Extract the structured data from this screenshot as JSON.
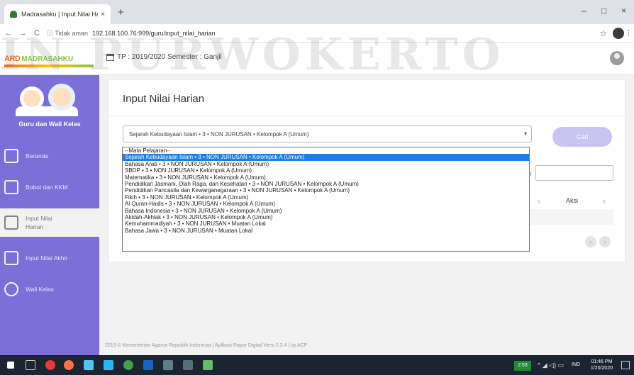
{
  "browser": {
    "tab_title": "Madrasahku | Input Nilai Harian",
    "tab_close": "×",
    "new_tab": "+",
    "window_controls": [
      "–",
      "□",
      "×"
    ],
    "security_text": "ⓘ Tidak aman",
    "url": "192.168.100.76:999/guru/input_nilai_harian",
    "nav_back": "←",
    "nav_forward": "→",
    "nav_reload": "C",
    "star": "☆",
    "menu": "⋮"
  },
  "header": {
    "logo_ard": "ARD",
    "logo_madrasahku": "MADRASAHKU",
    "tp_text": "TP : 2019/2020  Semester : Ganjil"
  },
  "watermark": "IN PURWOKERTO",
  "sidebar": {
    "role": "Guru dan Wali Kelas",
    "items": [
      {
        "label": "Beranda",
        "icon": "home-icon"
      },
      {
        "label": "Bobot dan KKM",
        "icon": "layers-icon"
      },
      {
        "label": "Input Nilai Harian",
        "icon": "document-icon"
      },
      {
        "label": "Input Nilai Akhir",
        "icon": "document-icon"
      },
      {
        "label": "Wali Kelas",
        "icon": "user-icon"
      }
    ]
  },
  "main": {
    "title": "Input Nilai Harian",
    "select_value": "Sejarah Kebudayaan Islam • 3 • NON JURUSAN • Kelompok A (Umum)",
    "select_arrow": "▾",
    "cari_label": "Cari",
    "search_label_fragment": "h",
    "aksi_label": "Aksi",
    "sort_glyph": "⇅",
    "pagination_prev": "‹",
    "pagination_next": "›",
    "options": [
      "--Mata Pelajaran--",
      "Sejarah Kebudayaan Islam • 3 • NON JURUSAN • Kelompok A (Umum)",
      "Bahasa Arab • 3 • NON JURUSAN • Kelompok A (Umum)",
      "SBDP • 3 • NON JURUSAN • Kelompok A (Umum)",
      "Matematika • 3 • NON JURUSAN • Kelompok A (Umum)",
      "Pendidikan Jasmani, Olah Raga, dan Kesehatan • 3 • NON JURUSAN • Kelompok A (Umum)",
      "Pendidikan Pancasila dan Kewarganegaraan • 3 • NON JURUSAN • Kelompok A (Umum)",
      "Fikih • 3 • NON JURUSAN • Kelompok A (Umum)",
      "Al Quran-Hadis • 3 • NON JURUSAN • Kelompok A (Umum)",
      "Bahasa Indonesia • 3 • NON JURUSAN • Kelompok A (Umum)",
      "Akidah-Akhlak • 3 • NON JURUSAN • Kelompok A (Umum)",
      "Kemuhammadiyah • 3 • NON JURUSAN • Muatan Lokal",
      "Bahasa Jawa • 3 • NON JURUSAN • Muatan Lokal"
    ],
    "selected_option_index": 1
  },
  "footer": "2019 © Kementerian Agama Republik Indonesia | Aplikasi Rapor Digital Versi 2.3.4 | by ACP",
  "taskbar": {
    "badge": "2:53",
    "tray": "^ ◢ ◁) ▭",
    "lang": "IND",
    "time": "01:46 PM",
    "date": "1/20/2020"
  },
  "colors": {
    "sidebar": "#7c6fd8",
    "select_highlight": "#1e7ee6",
    "cari_button": "#c9c4f0"
  }
}
